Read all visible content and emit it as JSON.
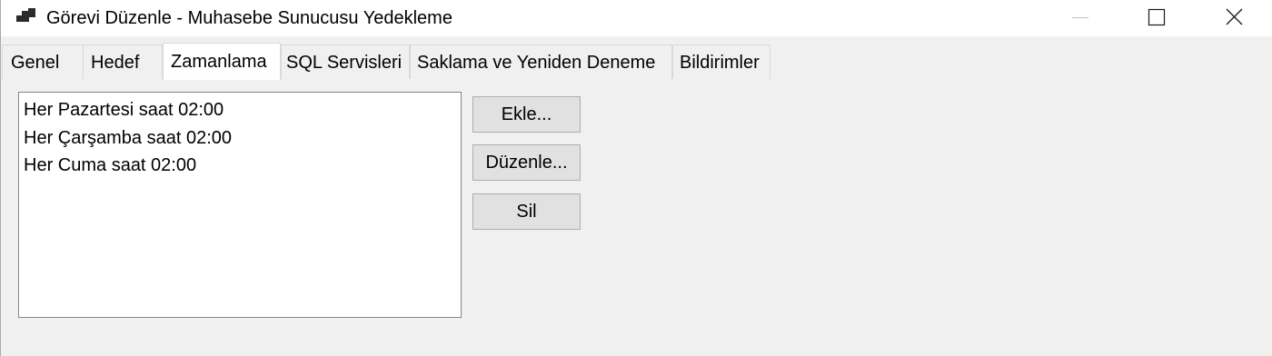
{
  "window": {
    "title": "Görevi Düzenle - Muhasebe Sunucusu Yedekleme",
    "app_icon": "window-app-icon",
    "controls": {
      "minimize_icon": "minimize-icon",
      "maximize_icon": "maximize-icon",
      "close_icon": "close-icon"
    }
  },
  "tabs": [
    {
      "label": "Genel",
      "active": false
    },
    {
      "label": "Hedef",
      "active": false
    },
    {
      "label": "Zamanlama",
      "active": true
    },
    {
      "label": "SQL Servisleri",
      "active": false
    },
    {
      "label": "Saklama ve Yeniden Deneme",
      "active": false
    },
    {
      "label": "Bildirimler",
      "active": false
    }
  ],
  "schedule": {
    "items": [
      "Her Pazartesi saat 02:00",
      "Her Çarşamba saat 02:00",
      "Her Cuma saat 02:00"
    ],
    "buttons": {
      "add": "Ekle...",
      "edit": "Düzenle...",
      "delete": "Sil"
    }
  },
  "colors": {
    "titlebar_bg": "#ffffff",
    "body_bg": "#f0f0f0",
    "button_bg": "#e1e1e1",
    "button_border": "#adadad",
    "list_border": "#828790"
  }
}
